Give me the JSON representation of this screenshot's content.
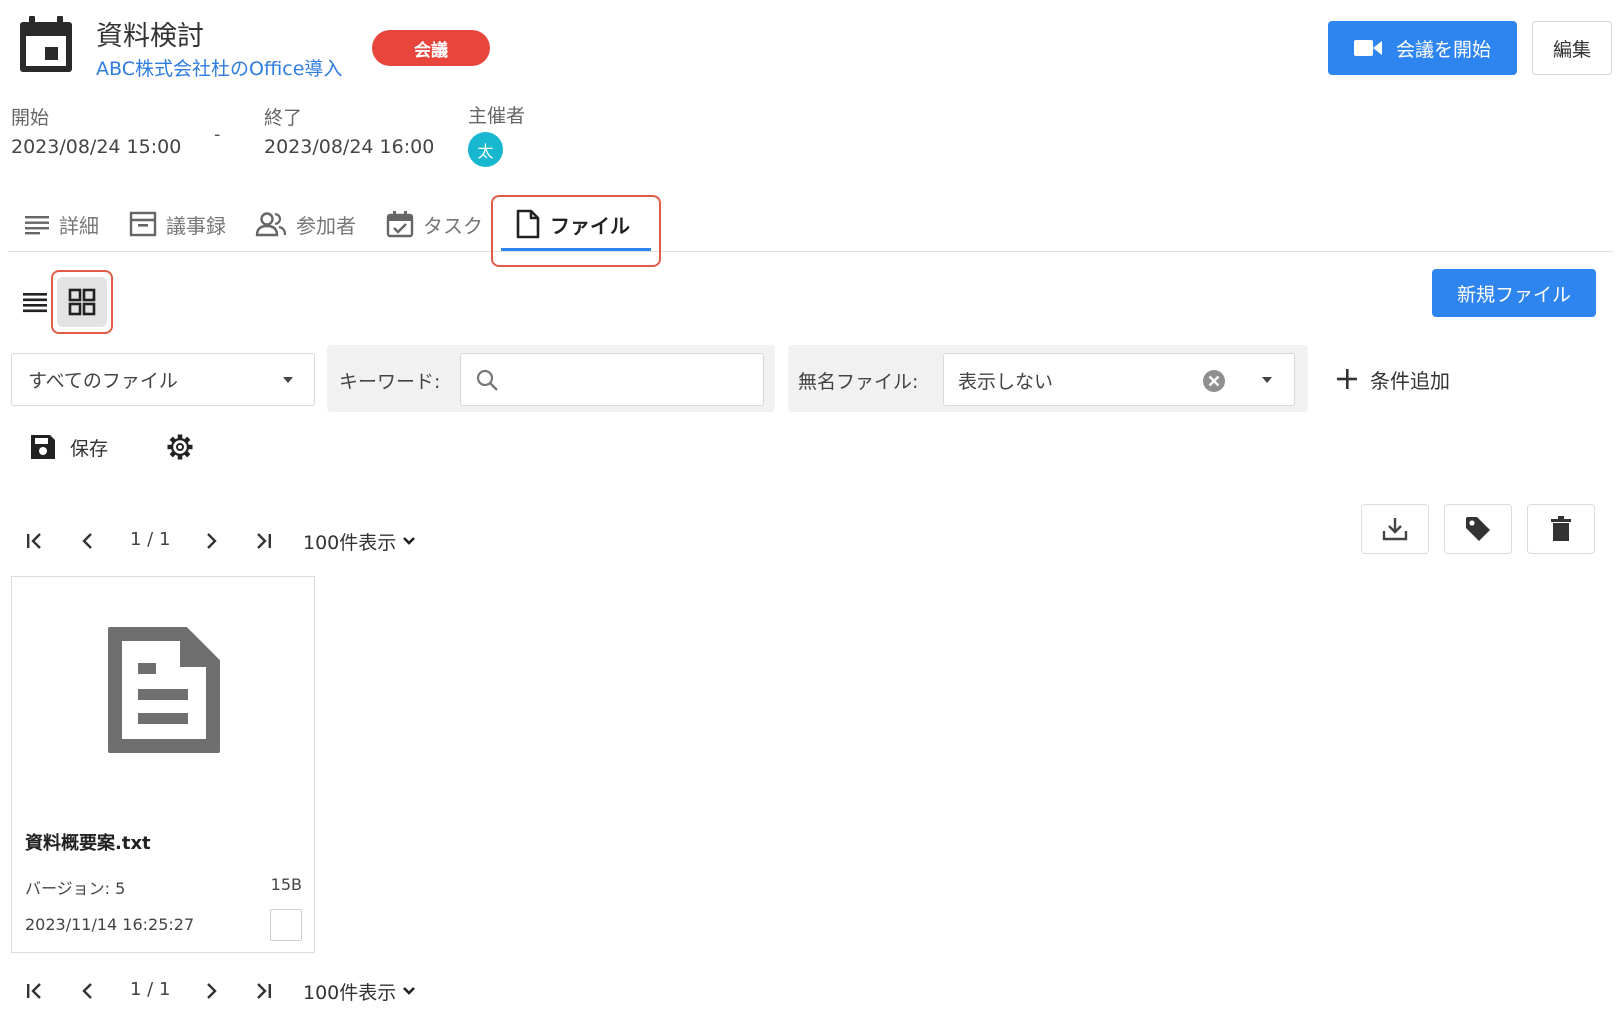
{
  "header": {
    "title": "資料検討",
    "subtitle": "ABC株式会社杜のOffice導入",
    "badge": "会議",
    "start_meeting_label": "会議を開始",
    "edit_label": "編集"
  },
  "meta": {
    "start_label": "開始",
    "start_value": "2023/08/24 15:00",
    "separator": "-",
    "end_label": "終了",
    "end_value": "2023/08/24 16:00",
    "host_label": "主催者",
    "host_initial": "太"
  },
  "tabs": [
    {
      "label": "詳細",
      "icon": "details-list-icon"
    },
    {
      "label": "議事録",
      "icon": "minutes-box-icon"
    },
    {
      "label": "参加者",
      "icon": "participants-icon"
    },
    {
      "label": "タスク",
      "icon": "task-calendar-icon"
    },
    {
      "label": "ファイル",
      "icon": "file-icon",
      "active": true
    }
  ],
  "toolbar": {
    "new_file_label": "新規ファイル",
    "save_label": "保存"
  },
  "filters": {
    "file_scope": "すべてのファイル",
    "keyword_label": "キーワード:",
    "keyword_value": "",
    "unnamed_label": "無名ファイル:",
    "unnamed_value": "表示しない",
    "add_condition_label": "条件追加"
  },
  "pagination": {
    "page_text": "1 / 1",
    "page_size_label": "100件表示"
  },
  "files": [
    {
      "name": "資料概要案.txt",
      "version": "バージョン: 5",
      "size": "15B",
      "updated": "2023/11/14 16:25:27"
    }
  ],
  "colors": {
    "primary": "#2f85ef",
    "link": "#2f7de1",
    "badge": "#e8453c",
    "avatar": "#16b7cf",
    "highlight": "#e05c47"
  }
}
